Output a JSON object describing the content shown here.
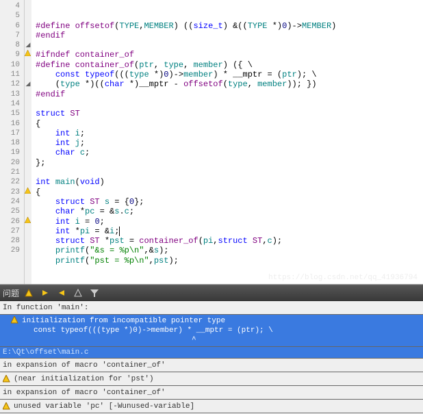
{
  "editor": {
    "lines": [
      {
        "n": 4,
        "mark": "",
        "tokens": [
          {
            "t": "#define ",
            "c": "kw-pre"
          },
          {
            "t": "offsetof",
            "c": "macro-name"
          },
          {
            "t": "(",
            "c": "op"
          },
          {
            "t": "TYPE",
            "c": "ident"
          },
          {
            "t": ",",
            "c": "op"
          },
          {
            "t": "MEMBER",
            "c": "ident"
          },
          {
            "t": ") ((",
            "c": "op"
          },
          {
            "t": "size_t",
            "c": "kw-type"
          },
          {
            "t": ") &((",
            "c": "op"
          },
          {
            "t": "TYPE",
            "c": "ident"
          },
          {
            "t": " *)",
            "c": "op"
          },
          {
            "t": "0",
            "c": "num"
          },
          {
            "t": ")->",
            "c": "op"
          },
          {
            "t": "MEMBER",
            "c": "ident"
          },
          {
            "t": ")",
            "c": "op"
          }
        ]
      },
      {
        "n": 5,
        "mark": "",
        "tokens": [
          {
            "t": "#endif",
            "c": "kw-pre"
          }
        ]
      },
      {
        "n": 6,
        "mark": "",
        "tokens": []
      },
      {
        "n": 7,
        "mark": "",
        "tokens": [
          {
            "t": "#ifndef ",
            "c": "kw-pre"
          },
          {
            "t": "container_of",
            "c": "macro-name"
          }
        ]
      },
      {
        "n": 8,
        "mark": "fold",
        "tokens": [
          {
            "t": "#define ",
            "c": "kw-pre"
          },
          {
            "t": "container_of",
            "c": "macro-name"
          },
          {
            "t": "(",
            "c": "op"
          },
          {
            "t": "ptr",
            "c": "ident"
          },
          {
            "t": ", ",
            "c": "op"
          },
          {
            "t": "type",
            "c": "ident"
          },
          {
            "t": ", ",
            "c": "op"
          },
          {
            "t": "member",
            "c": "ident"
          },
          {
            "t": ") ({ \\",
            "c": "op"
          }
        ]
      },
      {
        "n": 9,
        "mark": "warn",
        "tokens": [
          {
            "t": "    ",
            "c": "op"
          },
          {
            "t": "const ",
            "c": "kw-type"
          },
          {
            "t": "typeof",
            "c": "kw-type"
          },
          {
            "t": "(((",
            "c": "op"
          },
          {
            "t": "type",
            "c": "ident"
          },
          {
            "t": " *)",
            "c": "op"
          },
          {
            "t": "0",
            "c": "num"
          },
          {
            "t": ")->",
            "c": "op"
          },
          {
            "t": "member",
            "c": "ident"
          },
          {
            "t": ") * __mptr = (",
            "c": "op"
          },
          {
            "t": "ptr",
            "c": "ident"
          },
          {
            "t": "); \\",
            "c": "op"
          }
        ]
      },
      {
        "n": 10,
        "mark": "",
        "tokens": [
          {
            "t": "    (",
            "c": "op"
          },
          {
            "t": "type",
            "c": "ident"
          },
          {
            "t": " *)((",
            "c": "op"
          },
          {
            "t": "char",
            "c": "kw-type"
          },
          {
            "t": " *)__mptr - ",
            "c": "op"
          },
          {
            "t": "offsetof",
            "c": "macro-name"
          },
          {
            "t": "(",
            "c": "op"
          },
          {
            "t": "type",
            "c": "ident"
          },
          {
            "t": ", ",
            "c": "op"
          },
          {
            "t": "member",
            "c": "ident"
          },
          {
            "t": ")); })",
            "c": "op"
          }
        ]
      },
      {
        "n": 11,
        "mark": "",
        "tokens": [
          {
            "t": "#endif",
            "c": "kw-pre"
          }
        ]
      },
      {
        "n": 12,
        "mark": "fold",
        "tokens": []
      },
      {
        "n": 13,
        "mark": "",
        "tokens": [
          {
            "t": "struct ",
            "c": "kw-type"
          },
          {
            "t": "ST",
            "c": "struct-name"
          }
        ]
      },
      {
        "n": 14,
        "mark": "",
        "tokens": [
          {
            "t": "{",
            "c": "op"
          }
        ]
      },
      {
        "n": 15,
        "mark": "",
        "tokens": [
          {
            "t": "    ",
            "c": "op"
          },
          {
            "t": "int ",
            "c": "kw-type"
          },
          {
            "t": "i",
            "c": "ident"
          },
          {
            "t": ";",
            "c": "op"
          }
        ]
      },
      {
        "n": 16,
        "mark": "",
        "tokens": [
          {
            "t": "    ",
            "c": "op"
          },
          {
            "t": "int ",
            "c": "kw-type"
          },
          {
            "t": "j",
            "c": "ident"
          },
          {
            "t": ";",
            "c": "op"
          }
        ]
      },
      {
        "n": 17,
        "mark": "",
        "tokens": [
          {
            "t": "    ",
            "c": "op"
          },
          {
            "t": "char ",
            "c": "kw-type"
          },
          {
            "t": "c",
            "c": "ident"
          },
          {
            "t": ";",
            "c": "op"
          }
        ]
      },
      {
        "n": 18,
        "mark": "",
        "tokens": [
          {
            "t": "};",
            "c": "op"
          }
        ]
      },
      {
        "n": 19,
        "mark": "",
        "tokens": []
      },
      {
        "n": 20,
        "mark": "",
        "tokens": [
          {
            "t": "int ",
            "c": "kw-type"
          },
          {
            "t": "main",
            "c": "ident"
          },
          {
            "t": "(",
            "c": "op"
          },
          {
            "t": "void",
            "c": "kw-type"
          },
          {
            "t": ")",
            "c": "op"
          }
        ]
      },
      {
        "n": 21,
        "mark": "",
        "tokens": [
          {
            "t": "{",
            "c": "op"
          }
        ]
      },
      {
        "n": 22,
        "mark": "",
        "tokens": [
          {
            "t": "    ",
            "c": "op"
          },
          {
            "t": "struct ",
            "c": "kw-type"
          },
          {
            "t": "ST",
            "c": "struct-name"
          },
          {
            "t": " ",
            "c": "op"
          },
          {
            "t": "s",
            "c": "ident"
          },
          {
            "t": " = {",
            "c": "op"
          },
          {
            "t": "0",
            "c": "num"
          },
          {
            "t": "};",
            "c": "op"
          }
        ]
      },
      {
        "n": 23,
        "mark": "warn",
        "tokens": [
          {
            "t": "    ",
            "c": "op"
          },
          {
            "t": "char ",
            "c": "kw-type"
          },
          {
            "t": "*",
            "c": "op"
          },
          {
            "t": "pc",
            "c": "ident"
          },
          {
            "t": " = &",
            "c": "op"
          },
          {
            "t": "s",
            "c": "ident"
          },
          {
            "t": ".",
            "c": "op"
          },
          {
            "t": "c",
            "c": "ident"
          },
          {
            "t": ";",
            "c": "op"
          }
        ]
      },
      {
        "n": 24,
        "mark": "",
        "tokens": [
          {
            "t": "    ",
            "c": "op"
          },
          {
            "t": "int ",
            "c": "kw-type"
          },
          {
            "t": "i",
            "c": "ident"
          },
          {
            "t": " = ",
            "c": "op"
          },
          {
            "t": "0",
            "c": "num"
          },
          {
            "t": ";",
            "c": "op"
          }
        ]
      },
      {
        "n": 25,
        "mark": "",
        "tokens": [
          {
            "t": "    ",
            "c": "op"
          },
          {
            "t": "int ",
            "c": "kw-type"
          },
          {
            "t": "*",
            "c": "op"
          },
          {
            "t": "pi",
            "c": "ident"
          },
          {
            "t": " = &",
            "c": "op"
          },
          {
            "t": "i",
            "c": "ident"
          },
          {
            "t": ";",
            "c": "op"
          }
        ],
        "cursor": true
      },
      {
        "n": 26,
        "mark": "warn",
        "tokens": [
          {
            "t": "    ",
            "c": "op"
          },
          {
            "t": "struct ",
            "c": "kw-type"
          },
          {
            "t": "ST",
            "c": "struct-name"
          },
          {
            "t": " *",
            "c": "op"
          },
          {
            "t": "pst",
            "c": "ident"
          },
          {
            "t": " = ",
            "c": "op"
          },
          {
            "t": "container_of",
            "c": "macro-name"
          },
          {
            "t": "(",
            "c": "op"
          },
          {
            "t": "pi",
            "c": "ident"
          },
          {
            "t": ",",
            "c": "op"
          },
          {
            "t": "struct ",
            "c": "kw-type"
          },
          {
            "t": "ST",
            "c": "struct-name"
          },
          {
            "t": ",",
            "c": "op"
          },
          {
            "t": "c",
            "c": "ident"
          },
          {
            "t": ");",
            "c": "op"
          }
        ]
      },
      {
        "n": 27,
        "mark": "",
        "tokens": [
          {
            "t": "    ",
            "c": "op"
          },
          {
            "t": "printf",
            "c": "ident"
          },
          {
            "t": "(",
            "c": "op"
          },
          {
            "t": "\"&s = %p\\n\"",
            "c": "str"
          },
          {
            "t": ",&",
            "c": "op"
          },
          {
            "t": "s",
            "c": "ident"
          },
          {
            "t": ");",
            "c": "op"
          }
        ]
      },
      {
        "n": 28,
        "mark": "",
        "tokens": [
          {
            "t": "    ",
            "c": "op"
          },
          {
            "t": "printf",
            "c": "ident"
          },
          {
            "t": "(",
            "c": "op"
          },
          {
            "t": "\"pst = %p\\n\"",
            "c": "str"
          },
          {
            "t": ",",
            "c": "op"
          },
          {
            "t": "pst",
            "c": "ident"
          },
          {
            "t": ");",
            "c": "op"
          }
        ]
      },
      {
        "n": 29,
        "mark": "",
        "tokens": []
      }
    ]
  },
  "panel": {
    "title": "问题",
    "messages": [
      {
        "type": "plain",
        "icon": "",
        "text": "In function 'main':"
      },
      {
        "type": "selected-multi",
        "icon": "warn",
        "line1": "initialization from incompatible pointer type",
        "line2": "     const typeof(((type *)0)->member) * __mptr = (ptr); \\",
        "caret": "                                        ^"
      },
      {
        "type": "path",
        "text": "E:\\Qt\\offset\\main.c"
      },
      {
        "type": "plain",
        "icon": "",
        "text": "in expansion of macro 'container_of'"
      },
      {
        "type": "plain",
        "icon": "warn",
        "text": "(near initialization for 'pst')"
      },
      {
        "type": "plain",
        "icon": "",
        "text": "in expansion of macro 'container_of'"
      },
      {
        "type": "plain",
        "icon": "warn",
        "text": "unused variable 'pc' [-Wunused-variable]"
      }
    ]
  },
  "watermark": "https://blog.csdn.net/qq_41936794"
}
